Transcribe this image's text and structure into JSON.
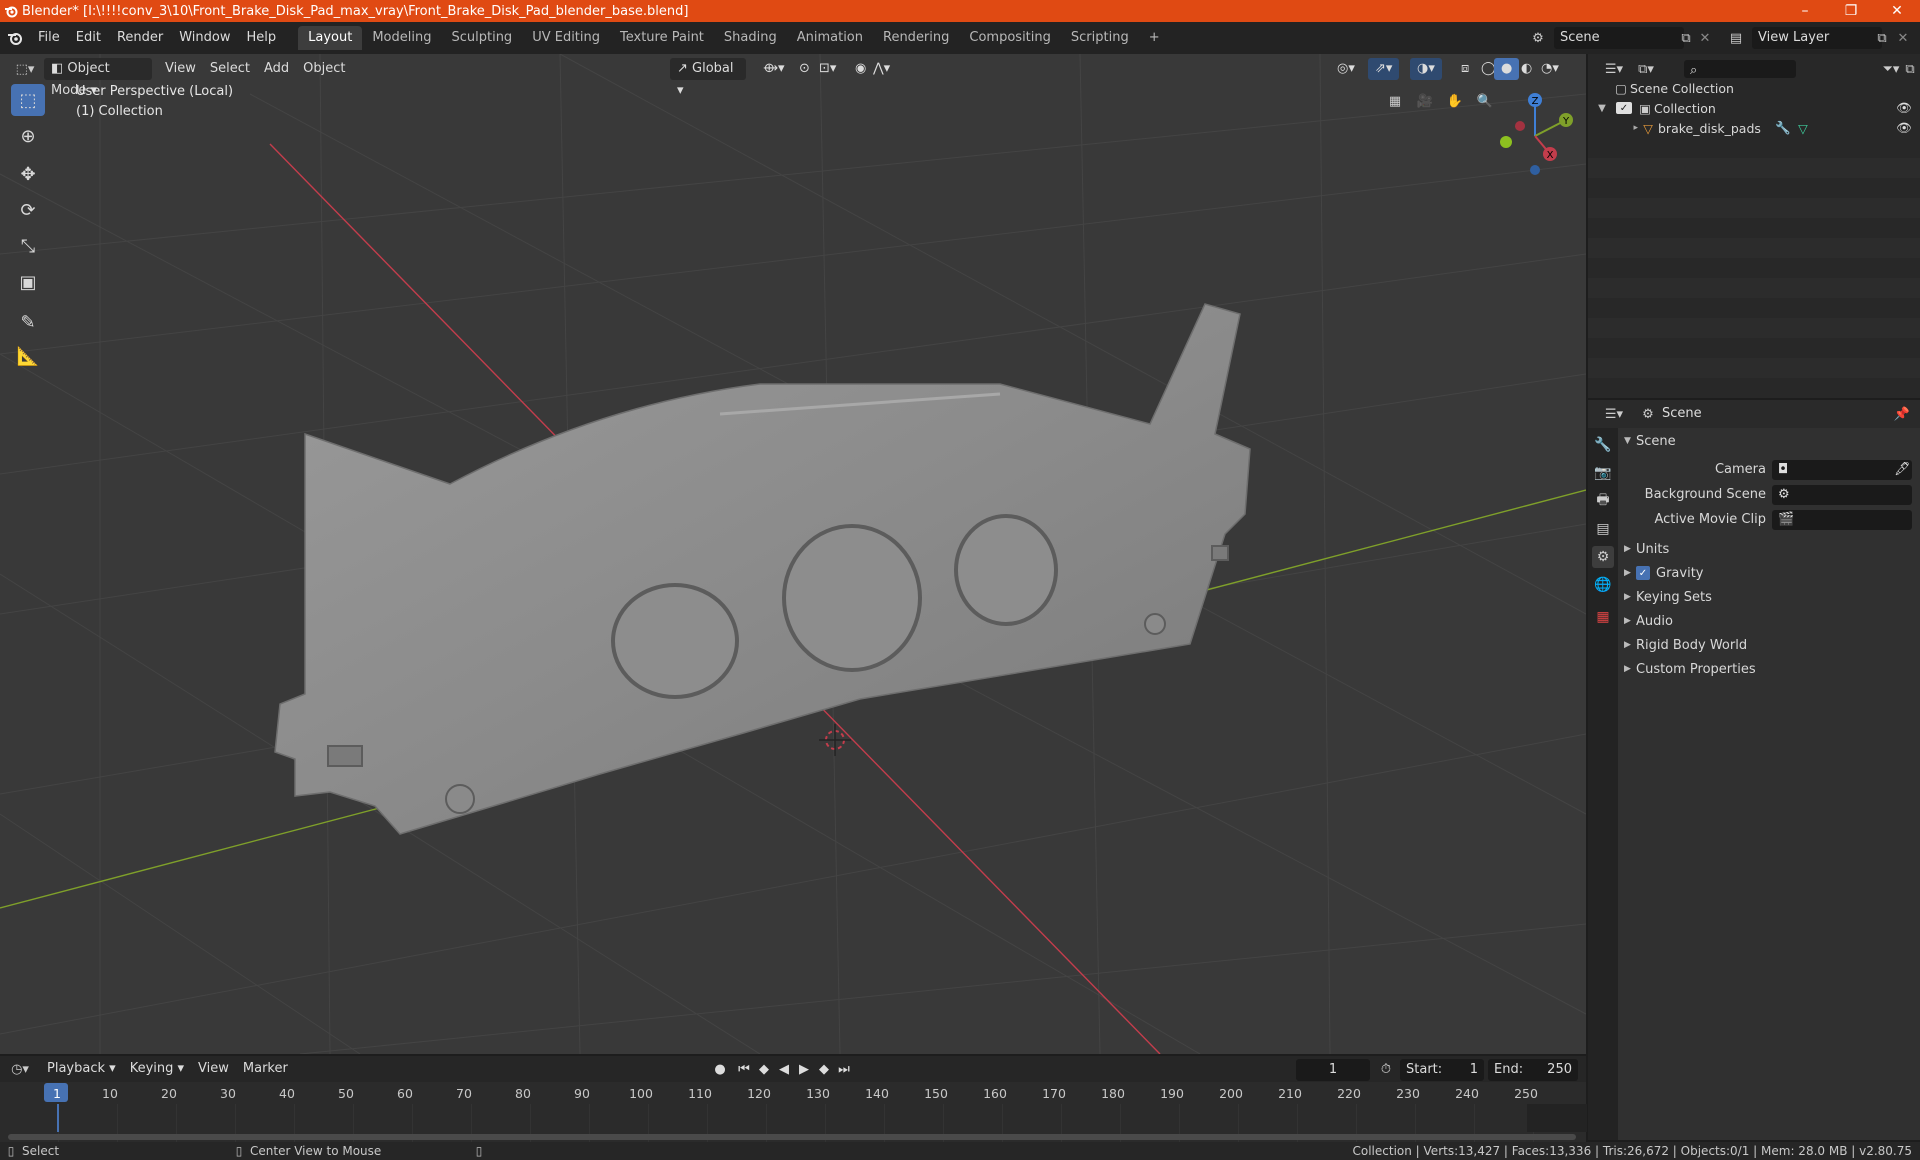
{
  "window": {
    "title": "Blender* [I:\\!!!!conv_3\\10\\Front_Brake_Disk_Pad_max_vray\\Front_Brake_Disk_Pad_blender_base.blend]",
    "minimize": "–",
    "restore": "❐",
    "close": "✕"
  },
  "menu": {
    "items": [
      "File",
      "Edit",
      "Render",
      "Window",
      "Help"
    ]
  },
  "workspaces": [
    "Layout",
    "Modeling",
    "Sculpting",
    "UV Editing",
    "Texture Paint",
    "Shading",
    "Animation",
    "Rendering",
    "Compositing",
    "Scripting"
  ],
  "workspace_add": "+",
  "scene_selector": {
    "value": "Scene"
  },
  "view_layer": {
    "value": "View Layer"
  },
  "viewport": {
    "mode": "Object Mode",
    "menus": [
      "View",
      "Select",
      "Add",
      "Object"
    ],
    "orientation": "Global",
    "perspective_label": "User Perspective (Local)",
    "collection_label": "(1) Collection",
    "gizmo": {
      "x": "X",
      "y": "Y",
      "z": "Z"
    }
  },
  "outliner": {
    "search_placeholder": "",
    "root": "Scene Collection",
    "collection": "Collection",
    "object": "brake_disk_pads"
  },
  "properties": {
    "header": "Scene",
    "panel_title": "Scene",
    "camera_label": "Camera",
    "background_scene_label": "Background Scene",
    "active_movie_clip_label": "Active Movie Clip",
    "sections": [
      "Units",
      "Gravity",
      "Keying Sets",
      "Audio",
      "Rigid Body World",
      "Custom Properties"
    ],
    "gravity_checked": true
  },
  "timeline": {
    "menus": [
      "Playback",
      "Keying",
      "View",
      "Marker"
    ],
    "current_frame": "1",
    "start_label": "Start:",
    "start": "1",
    "end_label": "End:",
    "end": "250",
    "ruler": [
      "1",
      "10",
      "20",
      "30",
      "40",
      "50",
      "60",
      "70",
      "80",
      "90",
      "100",
      "110",
      "120",
      "130",
      "140",
      "150",
      "160",
      "170",
      "180",
      "190",
      "200",
      "210",
      "220",
      "230",
      "240",
      "250"
    ]
  },
  "statusbar": {
    "select": "Select",
    "center_view": "Center View to Mouse",
    "stats": "Collection | Verts:13,427 | Faces:13,336 | Tris:26,672 | Objects:0/1 | Mem: 28.0 MB | v2.80.75"
  },
  "colors": {
    "titlebar": "#e04a13",
    "accent": "#4772b3",
    "x_axis": "#c33d4c",
    "y_axis": "#7fa02a",
    "z_axis": "#3f7fd6"
  }
}
